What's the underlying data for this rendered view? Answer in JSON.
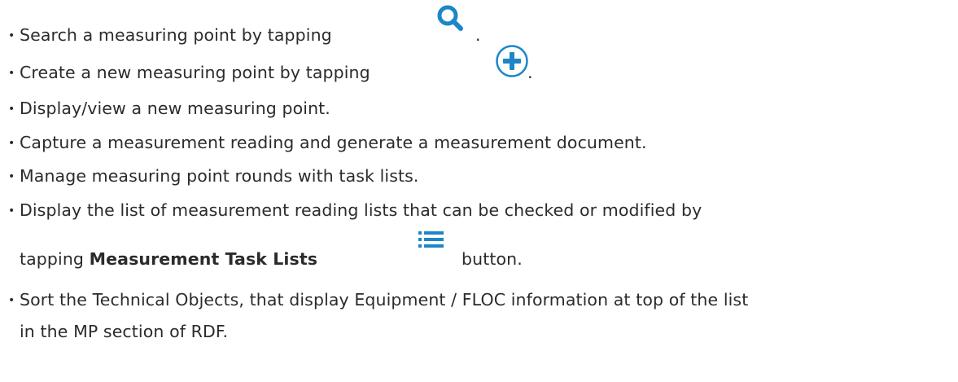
{
  "bullet_char": "•",
  "items": [
    {
      "pre": "Search a measuring point by tapping",
      "post": ".",
      "icon": "search-icon"
    },
    {
      "pre": "Create a new measuring point by tapping",
      "post": ".",
      "icon": "add-circle-icon"
    },
    {
      "text": "Display/view a new measuring point."
    },
    {
      "text": "Capture a measurement reading and generate a measurement document."
    },
    {
      "text": "Manage measuring point rounds with task lists."
    },
    {
      "text": "Display the list of measurement reading lists that can be checked or modified by",
      "cont_pre": "tapping ",
      "cont_bold": "Measurement Task Lists",
      "cont_post": "button.",
      "icon": "list-icon"
    },
    {
      "text": "Sort the Technical Objects, that display Equipment / FLOC information at top of the list",
      "cont": "in the MP section of RDF."
    }
  ],
  "colors": {
    "text": "#2b2b2b",
    "icon_blue": "#1c86c8"
  }
}
